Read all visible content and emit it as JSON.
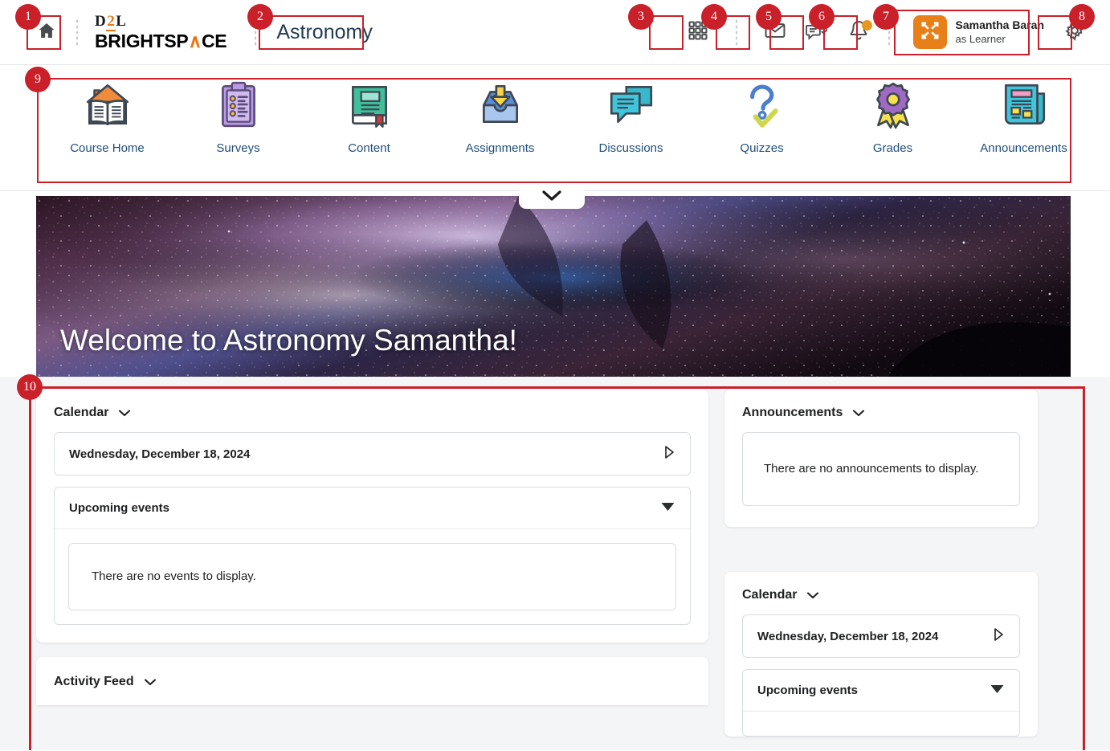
{
  "header": {
    "home_icon": "home-icon",
    "brand_line1": "D2L",
    "brand_line1_accent": "2",
    "brand_line2": "BRIGHTSP",
    "brand_line2_accent": "∧",
    "brand_line2_end": "CE",
    "course_title": "Astronomy",
    "icons": [
      {
        "name": "app-drawer-icon",
        "label": "Course Selector"
      },
      {
        "name": "envelope-icon",
        "label": "Message Alerts"
      },
      {
        "name": "chat-icon",
        "label": "Subscription Alerts"
      },
      {
        "name": "bell-icon",
        "label": "Update Alerts"
      }
    ],
    "profile": {
      "avatar_icon": "role-switch-icon",
      "name": "Samantha Baran",
      "role": "as Learner",
      "avatar_color": "#e8801a"
    },
    "settings_icon": "gear-icon"
  },
  "nav": {
    "items": [
      {
        "label": "Course Home",
        "icon": "open-book-house-icon"
      },
      {
        "label": "Surveys",
        "icon": "clipboard-icon"
      },
      {
        "label": "Content",
        "icon": "book-icon"
      },
      {
        "label": "Assignments",
        "icon": "inbox-arrow-icon"
      },
      {
        "label": "Discussions",
        "icon": "speech-bubbles-icon"
      },
      {
        "label": "Quizzes",
        "icon": "question-check-icon"
      },
      {
        "label": "Grades",
        "icon": "award-ribbon-icon"
      },
      {
        "label": "Announcements",
        "icon": "newspaper-icon"
      }
    ],
    "collapse_icon": "chevron-down-icon"
  },
  "banner": {
    "title": "Welcome to Astronomy Samantha!",
    "image_alt": "milky-way-galaxy-night-sky"
  },
  "main": {
    "left": {
      "calendar": {
        "title": "Calendar",
        "collapse_icon": "chevron-down-icon",
        "date": "Wednesday, December 18, 2024",
        "date_arrow_icon": "triangle-right-icon",
        "events_title": "Upcoming events",
        "events_caret_icon": "caret-down-icon",
        "empty_message": "There are no events to display."
      },
      "activity_feed": {
        "title": "Activity Feed",
        "collapse_icon": "chevron-down-icon"
      }
    },
    "right": {
      "announcements": {
        "title": "Announcements",
        "collapse_icon": "chevron-down-icon",
        "empty_message": "There are no announcements to display."
      },
      "calendar": {
        "title": "Calendar",
        "collapse_icon": "chevron-down-icon",
        "date": "Wednesday, December 18, 2024",
        "date_arrow_icon": "triangle-right-icon",
        "events_title": "Upcoming events",
        "events_caret_icon": "caret-down-icon"
      }
    }
  },
  "annotations": {
    "color": "#c9202a",
    "callouts": [
      {
        "num": "1"
      },
      {
        "num": "2"
      },
      {
        "num": "3"
      },
      {
        "num": "4"
      },
      {
        "num": "5"
      },
      {
        "num": "6"
      },
      {
        "num": "7"
      },
      {
        "num": "8"
      },
      {
        "num": "9"
      },
      {
        "num": "10"
      }
    ]
  }
}
